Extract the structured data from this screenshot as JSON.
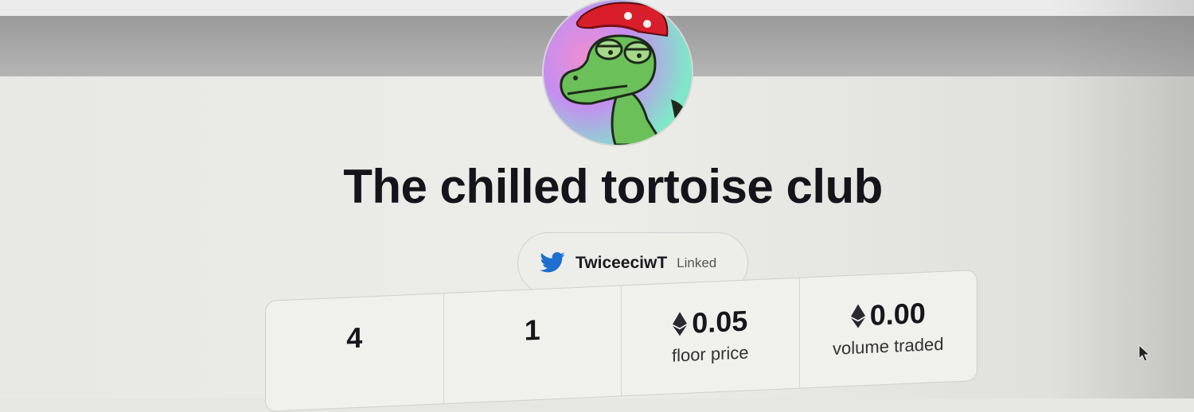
{
  "collection": {
    "title": "The chilled tortoise club",
    "avatar_icon": "tortoise-avatar-icon"
  },
  "social": {
    "icon": "twitter-icon",
    "handle": "TwiceeciwT",
    "status": "Linked"
  },
  "stats": [
    {
      "value": "4",
      "label": "",
      "has_eth": false
    },
    {
      "value": "1",
      "label": "",
      "has_eth": false
    },
    {
      "value": "0.05",
      "label": "floor price",
      "has_eth": true
    },
    {
      "value": "0.00",
      "label": "volume traded",
      "has_eth": true
    }
  ],
  "colors": {
    "twitter": "#1d9bf0",
    "cap_red": "#d81e2a",
    "tortoise_green": "#6cc05a"
  }
}
